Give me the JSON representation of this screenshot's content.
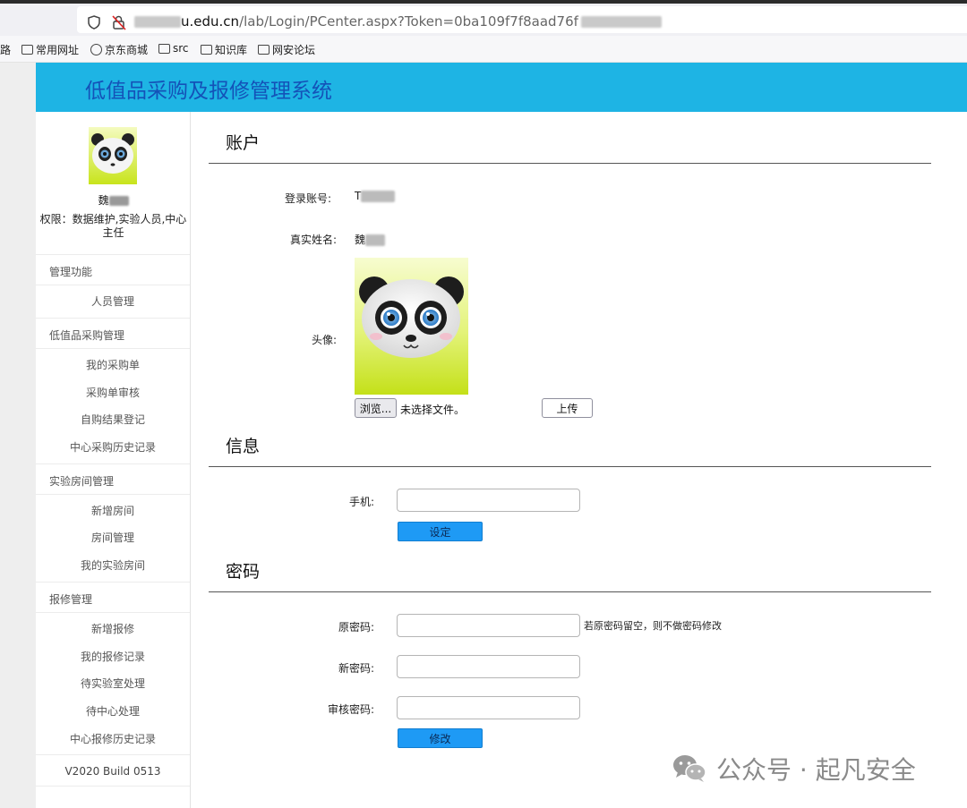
{
  "browser": {
    "url_host_suffix": "u.edu.cn",
    "url_path": "/lab/Login/PCenter.aspx?Token=0ba109f7f8aad76f",
    "bookmarks": [
      "路",
      "常用网址",
      "京东商城",
      "src",
      "知识库",
      "网安论坛"
    ]
  },
  "app": {
    "title": "低值品采购及报修管理系统",
    "header_color": "#1eb4e4",
    "title_color": "#1452b8"
  },
  "sidebar": {
    "name_initial": "魏",
    "permissions": "权限：数据维护,实验人员,中心主任",
    "sections": [
      {
        "title": "管理功能",
        "items": [
          "人员管理"
        ]
      },
      {
        "title": "低值品采购管理",
        "items": [
          "我的采购单",
          "采购单审核",
          "自购结果登记",
          "中心采购历史记录"
        ]
      },
      {
        "title": "实验房间管理",
        "items": [
          "新增房间",
          "房间管理",
          "我的实验房间"
        ]
      },
      {
        "title": "报修管理",
        "items": [
          "新增报修",
          "我的报修记录",
          "待实验室处理",
          "待中心处理",
          "中心报修历史记录"
        ]
      }
    ],
    "version": "V2020 Build 0513"
  },
  "account": {
    "title": "账户",
    "login_label": "登录账号:",
    "login_value": "T",
    "realname_label": "真实姓名:",
    "realname_value": "魏",
    "avatar_label": "头像:",
    "browse_label": "浏览...",
    "no_file_text": "未选择文件。",
    "upload_label": "上传"
  },
  "info": {
    "title": "信息",
    "phone_label": "手机:",
    "phone_value": "",
    "set_label": "设定"
  },
  "password": {
    "title": "密码",
    "old_label": "原密码:",
    "old_hint": "若原密码留空，则不做密码修改",
    "new_label": "新密码:",
    "audit_label": "审核密码:",
    "modify_label": "修改"
  },
  "watermark": {
    "text": "公众号 · 起凡安全"
  },
  "icons": {
    "shield": "shield-icon",
    "lock": "lock-icon",
    "folder": "folder-icon",
    "globe": "globe-icon",
    "avatar": "panda-avatar",
    "wechat": "wechat-icon"
  }
}
